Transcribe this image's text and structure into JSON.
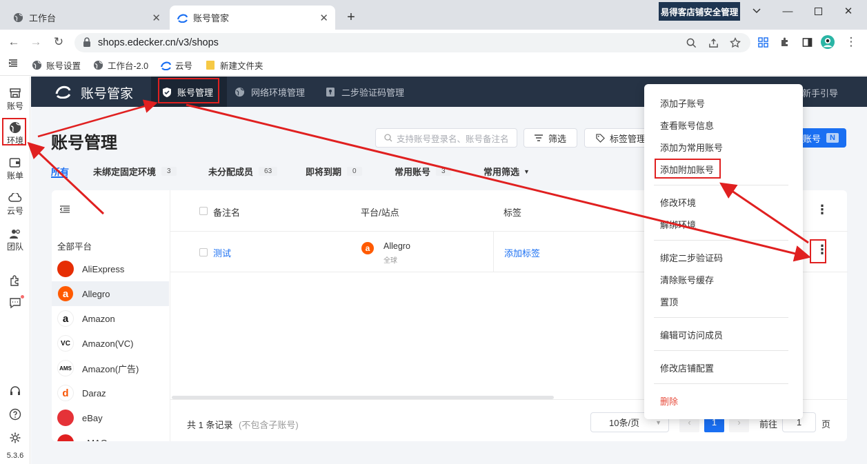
{
  "browser": {
    "tabs": [
      {
        "label": "工作台",
        "icon": "globe-icon"
      },
      {
        "label": "账号管家",
        "icon": "edecker-logo-icon"
      }
    ],
    "extension_badge": "易得客店铺安全管理",
    "url": "shops.edecker.cn/v3/shops",
    "bookmarks": [
      "账号设置",
      "工作台-2.0",
      "云号",
      "新建文件夹"
    ]
  },
  "left_nav": {
    "items": [
      {
        "label": "账号",
        "icon": "store-icon"
      },
      {
        "label": "环境",
        "icon": "globe-icon"
      },
      {
        "label": "账单",
        "icon": "wallet-icon"
      },
      {
        "label": "云号",
        "icon": "cloud-icon"
      },
      {
        "label": "团队",
        "icon": "team-icon"
      }
    ],
    "version": "5.3.6"
  },
  "app": {
    "brand": "账号管家",
    "nav": [
      "账号管理",
      "网络环境管理",
      "二步验证码管理"
    ],
    "guide": "新手引导"
  },
  "page": {
    "title": "账号管理",
    "search_placeholder": "支持账号登录名、账号备注名",
    "filter_btn": "筛选",
    "tag_btn": "标签管理",
    "add_btn": "账号",
    "add_btn_badge": "N",
    "filters": [
      {
        "label": "所有",
        "count": ""
      },
      {
        "label": "未绑定固定环境",
        "count": "3"
      },
      {
        "label": "未分配成员",
        "count": "63"
      },
      {
        "label": "即将到期",
        "count": "0"
      },
      {
        "label": "常用账号",
        "count": "3"
      },
      {
        "label": "常用筛选",
        "count": ""
      }
    ]
  },
  "platforms": {
    "header": "全部平台",
    "items": [
      {
        "name": "AliExpress",
        "glyph": "",
        "color": "#e62e04"
      },
      {
        "name": "Allegro",
        "glyph": "a",
        "color": "#ff5a00"
      },
      {
        "name": "Amazon",
        "glyph": "a",
        "color": "#111111"
      },
      {
        "name": "Amazon(VC)",
        "glyph": "VC",
        "color": "#111111"
      },
      {
        "name": "Amazon(广告)",
        "glyph": "AMS",
        "color": "#111111"
      },
      {
        "name": "Daraz",
        "glyph": "d",
        "color": "#f85606"
      },
      {
        "name": "eBay",
        "glyph": "",
        "color": "#e53238"
      },
      {
        "name": "eMAG",
        "glyph": "",
        "color": "#e02020"
      }
    ]
  },
  "table": {
    "columns": [
      "备注名",
      "平台/站点",
      "标签"
    ],
    "rows": [
      {
        "name": "测试",
        "platform": "Allegro",
        "region": "全球",
        "tag": "添加标签"
      }
    ],
    "total": "共 1 条记录",
    "total_note": "(不包含子账号)",
    "page_size": "10条/页",
    "current_page": "1",
    "goto_label": "前往",
    "goto_value": "1",
    "page_unit": "页"
  },
  "context_menu": {
    "items": [
      "添加子账号",
      "查看账号信息",
      "添加为常用账号",
      "添加附加账号",
      "修改环境",
      "解绑环境",
      "绑定二步验证码",
      "清除账号缓存",
      "置顶",
      "编辑可访问成员",
      "修改店铺配置",
      "删除"
    ]
  },
  "colors": {
    "primary": "#1a6ff2",
    "header_bg": "#263345",
    "annotation": "#e02020",
    "danger": "#e74c3c"
  }
}
